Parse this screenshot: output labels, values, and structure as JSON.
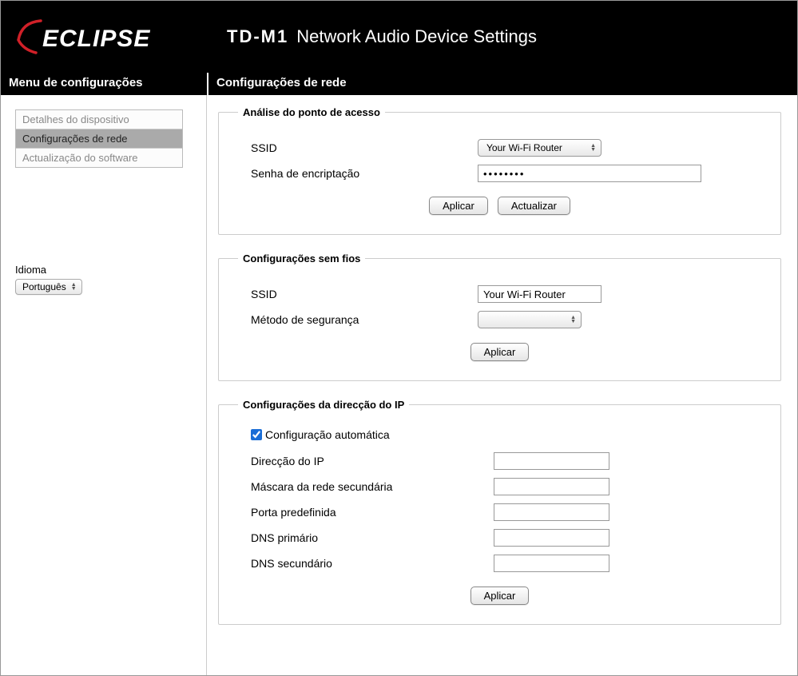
{
  "header": {
    "brand": "ECLIPSE",
    "model": "TD-M1",
    "subtitle": "Network Audio Device Settings"
  },
  "sidebar": {
    "menu_title": "Menu de configurações",
    "items": [
      {
        "label": "Detalhes do dispositivo",
        "active": false
      },
      {
        "label": "Configurações de rede",
        "active": true
      },
      {
        "label": "Actualização do software",
        "active": false
      }
    ],
    "language_label": "Idioma",
    "language_value": "Português"
  },
  "main": {
    "title": "Configurações de rede",
    "section_ap": {
      "legend": "Análise do ponto de acesso",
      "ssid_label": "SSID",
      "ssid_value": "Your Wi-Fi Router",
      "pwd_label": "Senha de encriptação",
      "pwd_value": "••••••••",
      "apply": "Aplicar",
      "refresh": "Actualizar"
    },
    "section_wifi": {
      "legend": "Configurações sem fios",
      "ssid_label": "SSID",
      "ssid_value": "Your Wi-Fi Router",
      "security_label": "Método de segurança",
      "security_value": "",
      "apply": "Aplicar"
    },
    "section_ip": {
      "legend": "Configurações da direcção do IP",
      "auto_label": "Configuração automática",
      "auto_checked": true,
      "rows": [
        {
          "label": "Direcção do IP",
          "value": ""
        },
        {
          "label": "Máscara da rede secundária",
          "value": ""
        },
        {
          "label": "Porta predefinida",
          "value": ""
        },
        {
          "label": "DNS primário",
          "value": ""
        },
        {
          "label": "DNS secundário",
          "value": ""
        }
      ],
      "apply": "Aplicar"
    }
  }
}
